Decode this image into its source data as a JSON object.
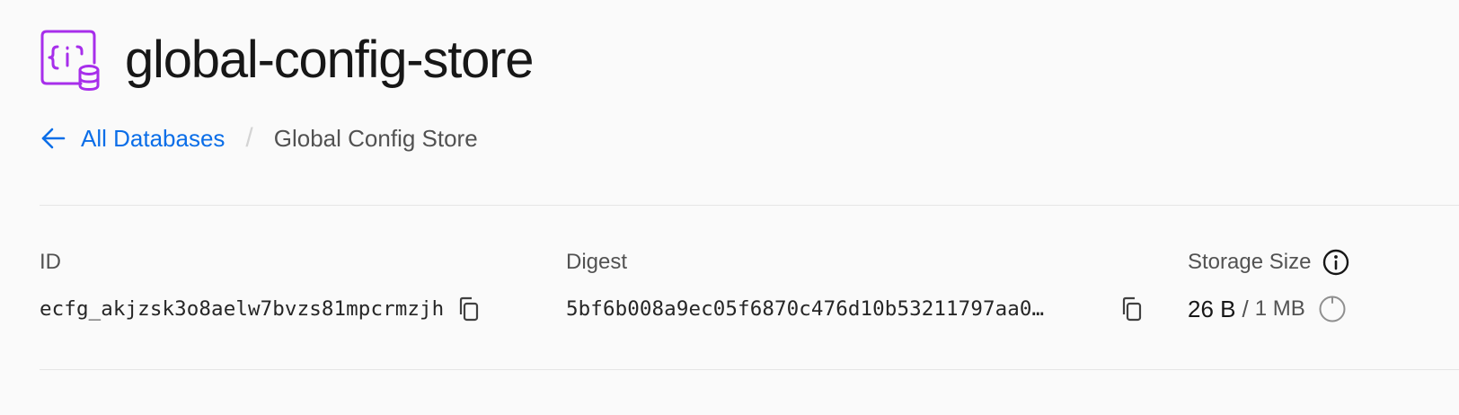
{
  "header": {
    "title": "global-config-store",
    "icon": "edge-config-database-icon",
    "icon_color": "#a72eeb"
  },
  "breadcrumb": {
    "back_icon": "arrow-left-icon",
    "back_label": "All Databases",
    "separator": "/",
    "current": "Global Config Store",
    "link_color": "#0b6ee8"
  },
  "details": {
    "id": {
      "label": "ID",
      "value": "ecfg_akjzsk3o8aelw7bvzs81mpcrmzjh",
      "copy_icon": "copy-icon"
    },
    "digest": {
      "label": "Digest",
      "value": "5bf6b008a9ec05f6870c476d10b53211797aa0…",
      "copy_icon": "copy-icon"
    },
    "storage": {
      "label": "Storage Size",
      "info_icon": "info-icon",
      "used": "26 B",
      "separator": "/",
      "limit": "1 MB",
      "usage_fraction": 2.5e-05,
      "usage_icon": "usage-ring-icon"
    }
  }
}
